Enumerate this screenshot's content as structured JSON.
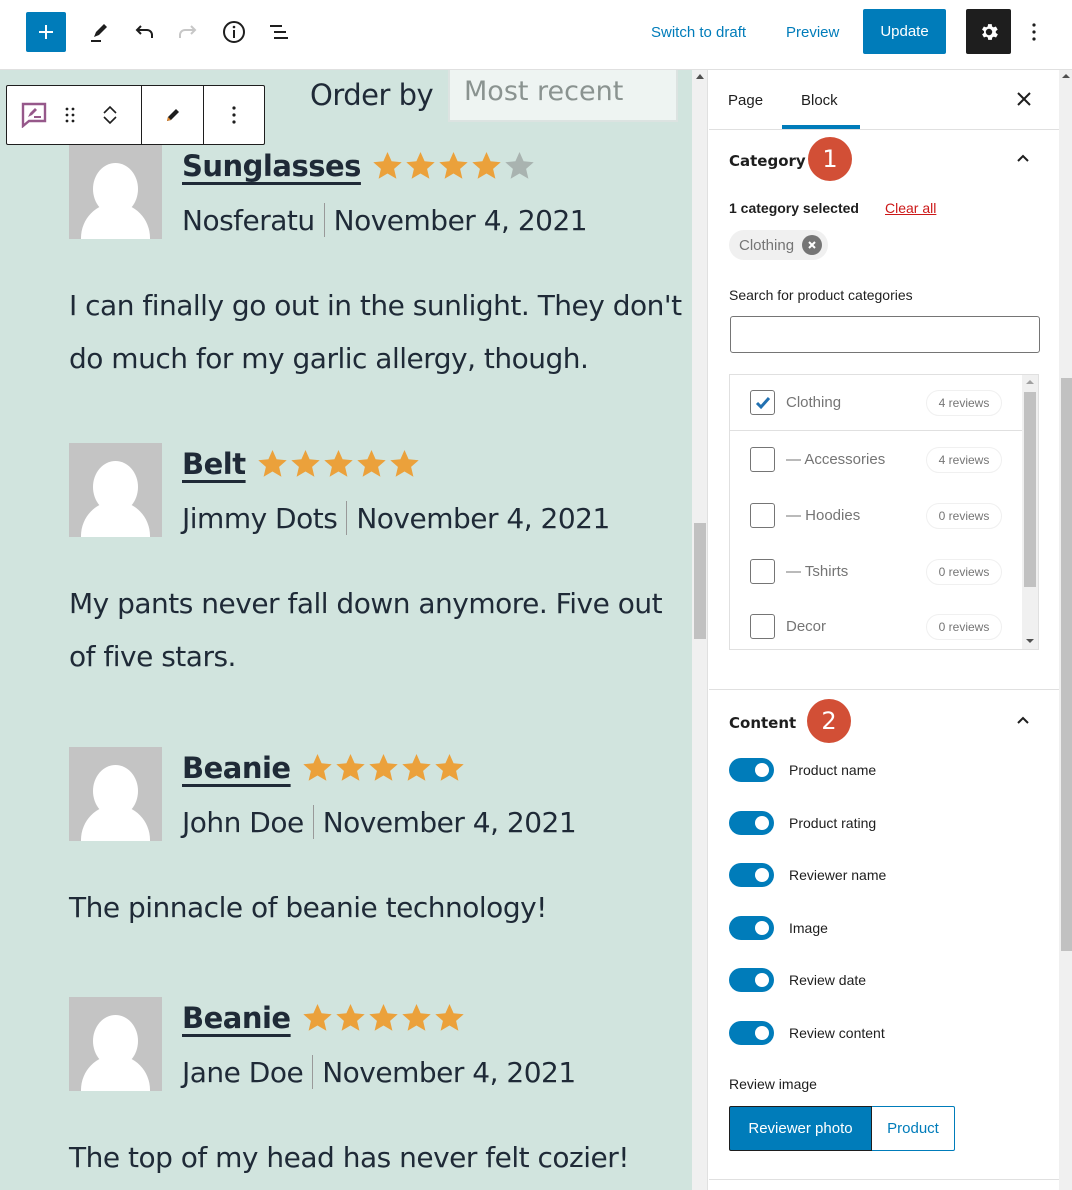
{
  "topbar": {
    "icons": [
      "plus-icon",
      "pencil-icon",
      "undo-icon",
      "redo-icon",
      "info-icon",
      "list-view-icon"
    ],
    "switch_to_draft": "Switch to draft",
    "preview": "Preview",
    "update": "Update",
    "settings_icon": "gear-icon",
    "more_icon": "vertical-ellipsis-icon",
    "accent": "#007cba"
  },
  "canvas": {
    "order_by_label": "Order by",
    "order_by_value": "Most recent",
    "background": "#d1e4de",
    "star_color": "#eba13b",
    "star_empty_color": "#a9b3b0",
    "reviews": [
      {
        "product": "Sunglasses",
        "rating": 4,
        "reviewer": "Nosferatu",
        "date": "November 4, 2021",
        "text": "I can finally go out in the sunlight. They don't do much for my garlic allergy, though."
      },
      {
        "product": "Belt",
        "rating": 5,
        "reviewer": "Jimmy Dots",
        "date": "November 4, 2021",
        "text": "My pants never fall down anymore. Five out of five stars."
      },
      {
        "product": "Beanie",
        "rating": 5,
        "reviewer": "John Doe",
        "date": "November 4, 2021",
        "text": "The pinnacle of beanie technology!"
      },
      {
        "product": "Beanie",
        "rating": 5,
        "reviewer": "Jane Doe",
        "date": "November 4, 2021",
        "text": "The top of my head has never felt cozier!"
      }
    ]
  },
  "sidebar": {
    "tabs": [
      {
        "label": "Page",
        "active": false
      },
      {
        "label": "Block",
        "active": true
      }
    ],
    "category": {
      "title": "Category",
      "badge": "1",
      "selected_count": "1 category selected",
      "clear_all": "Clear all",
      "chip": "Clothing",
      "search_label": "Search for product categories",
      "search_value": "",
      "items": [
        {
          "name": "Clothing",
          "count": "4 reviews",
          "checked": true
        },
        {
          "name": "— Accessories",
          "count": "4 reviews",
          "checked": false
        },
        {
          "name": "— Hoodies",
          "count": "0 reviews",
          "checked": false
        },
        {
          "name": "— Tshirts",
          "count": "0 reviews",
          "checked": false
        },
        {
          "name": "Decor",
          "count": "0 reviews",
          "checked": false
        }
      ]
    },
    "content": {
      "title": "Content",
      "badge": "2",
      "toggles": [
        {
          "label": "Product name",
          "on": true
        },
        {
          "label": "Product rating",
          "on": true
        },
        {
          "label": "Reviewer name",
          "on": true
        },
        {
          "label": "Image",
          "on": true
        },
        {
          "label": "Review date",
          "on": true
        },
        {
          "label": "Review content",
          "on": true
        }
      ],
      "review_image_label": "Review image",
      "review_image_options": [
        {
          "label": "Reviewer photo",
          "selected": true
        },
        {
          "label": "Product",
          "selected": false
        }
      ]
    },
    "badge_color": "#d24f36"
  }
}
